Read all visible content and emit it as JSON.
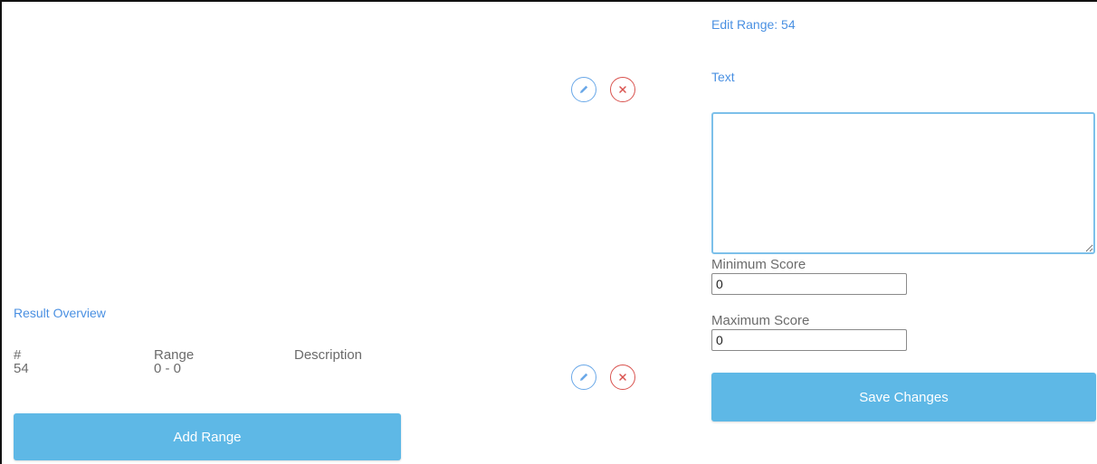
{
  "left_panel": {
    "section_title": "Result Overview",
    "table": {
      "headers": [
        "#",
        "Range",
        "Description"
      ],
      "rows": [
        {
          "id": "54",
          "range": "0 - 0",
          "description": ""
        }
      ]
    },
    "add_button_label": "Add Range"
  },
  "actions": {
    "edit_icon": "pencil-icon",
    "delete_icon": "close-icon"
  },
  "edit_panel": {
    "title": "Edit Range: 54",
    "text_label": "Text",
    "text_value": "",
    "min_label": "Minimum Score",
    "min_value": "0",
    "max_label": "Maximum Score",
    "max_value": "0",
    "save_button_label": "Save Changes"
  },
  "colors": {
    "accent_blue": "#4a90e2",
    "button_blue": "#5eb8e6",
    "delete_red": "#d9534f"
  }
}
